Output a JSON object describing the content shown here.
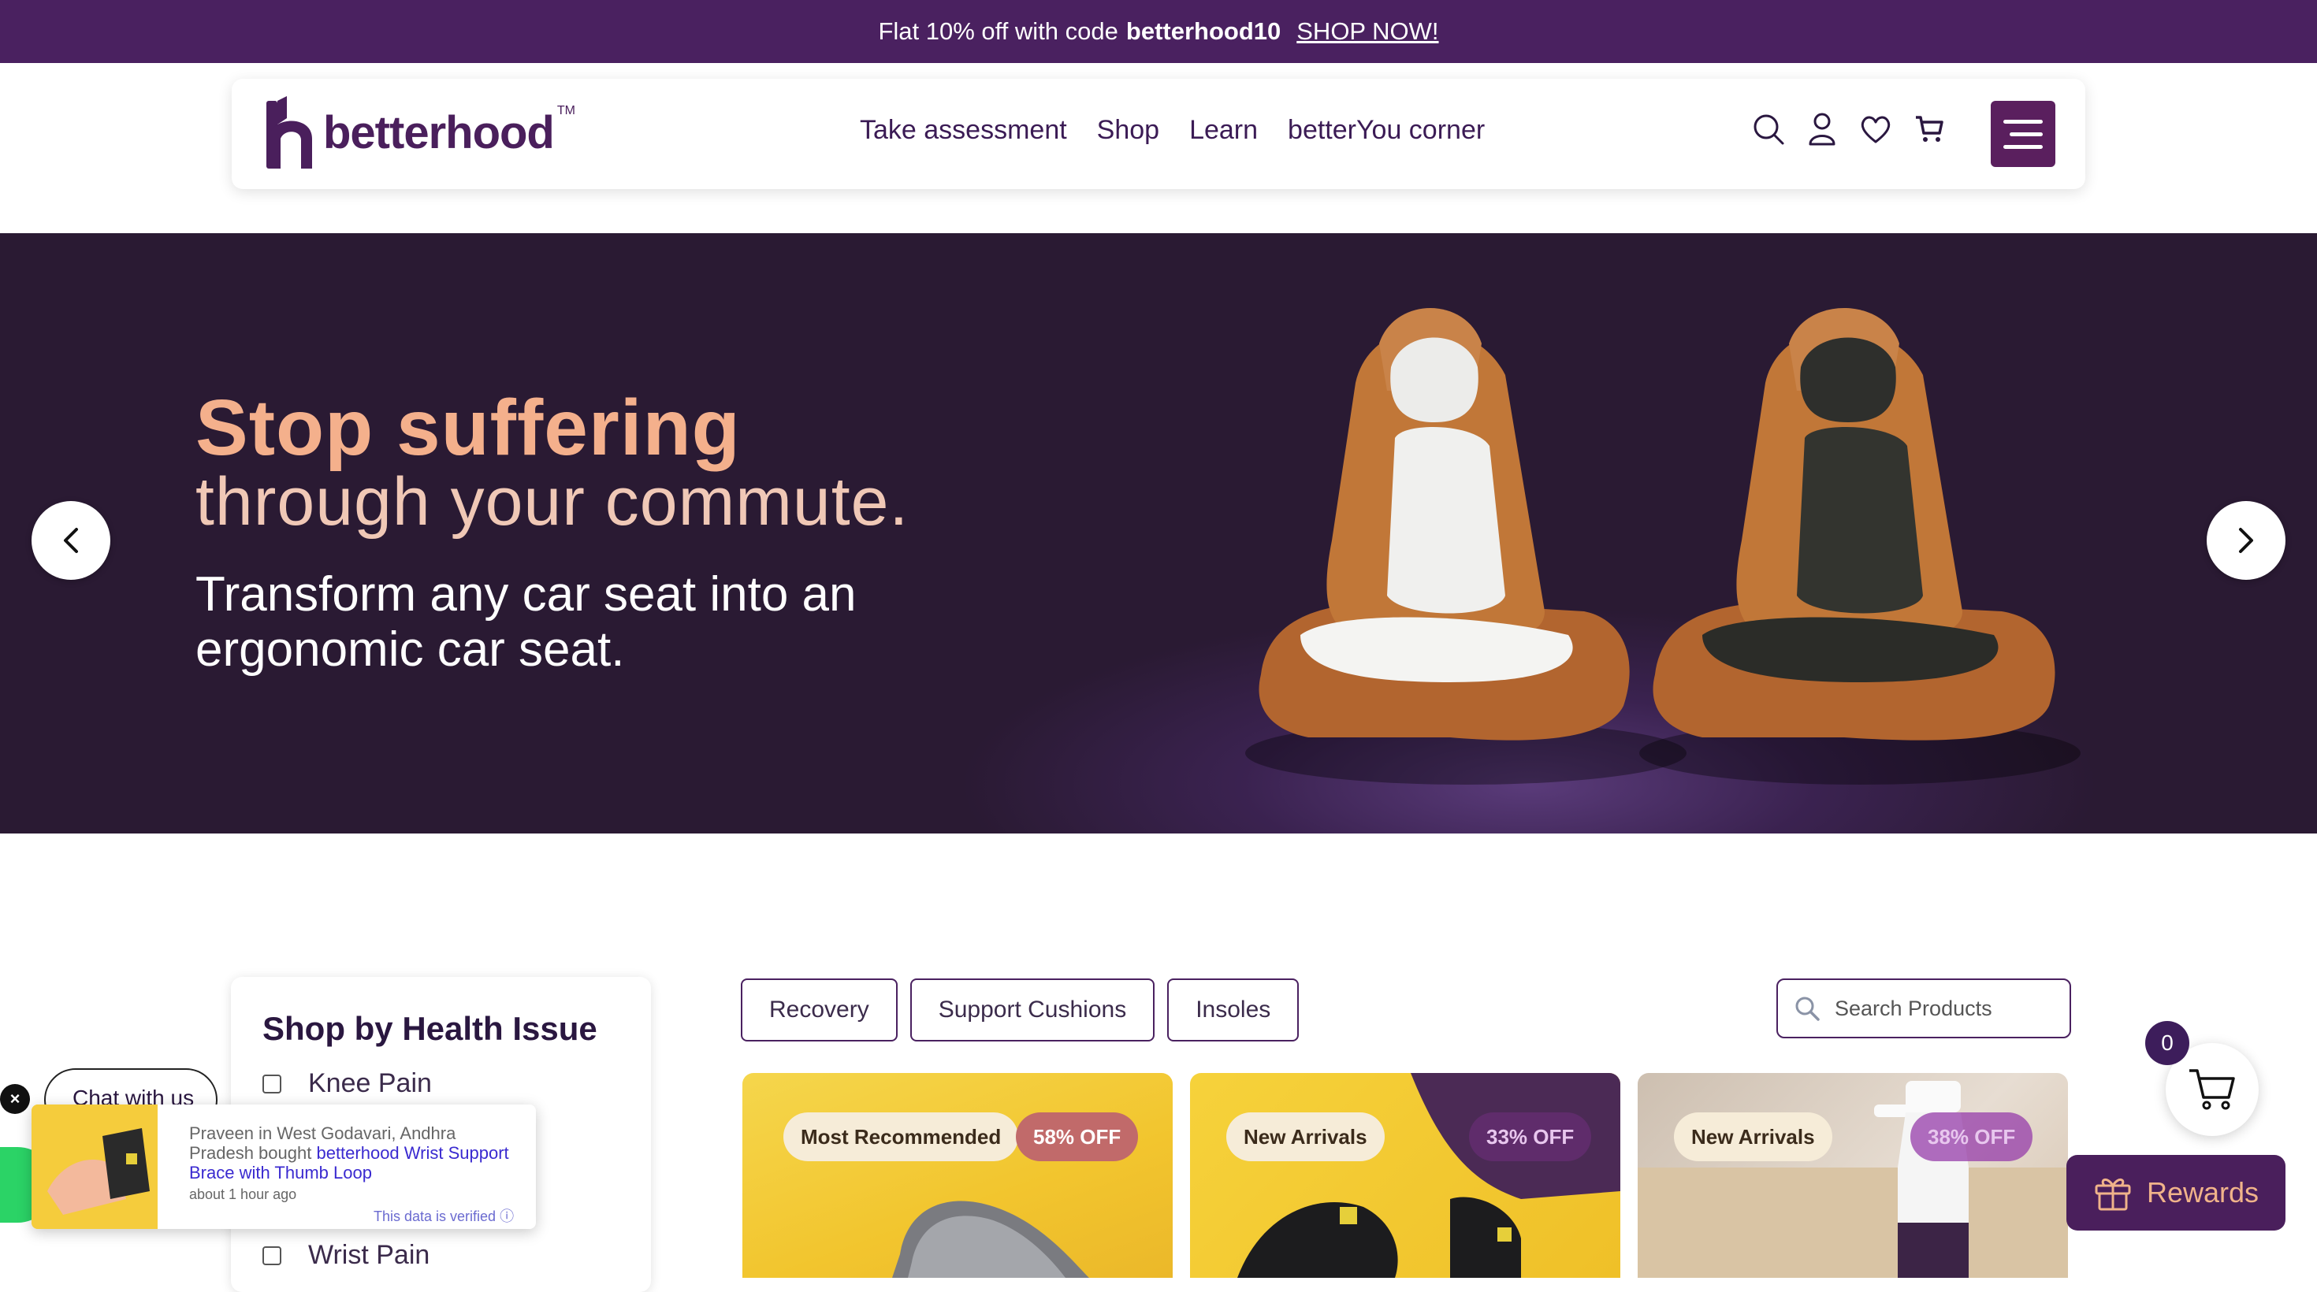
{
  "announcement": {
    "prefix": "Flat 10% off with code",
    "code": "betterhood10",
    "cta": "SHOP NOW!"
  },
  "header": {
    "brand": "betterhood",
    "trademark": "TM",
    "nav": [
      "Take assessment",
      "Shop",
      "Learn",
      "betterYou corner"
    ],
    "icons": [
      "search-icon",
      "user-icon",
      "heart-icon",
      "cart-icon",
      "menu-icon"
    ]
  },
  "hero": {
    "headline": "Stop suffering",
    "subheadline": "through your commute.",
    "body": "Transform any car seat into an ergonomic car seat.",
    "colors": {
      "headline": "#f4b08c",
      "background": "#2a1a33"
    }
  },
  "sidebar": {
    "title": "Shop by Health Issue",
    "filters": [
      "Knee Pain",
      "Wrist Pain"
    ]
  },
  "tabs": [
    "Recovery",
    "Support Cushions",
    "Insoles"
  ],
  "search": {
    "placeholder": "Search Products"
  },
  "products": [
    {
      "tag": "Most Recommended",
      "discount": "58% OFF"
    },
    {
      "tag": "New Arrivals",
      "discount": "33% OFF"
    },
    {
      "tag": "New Arrivals",
      "discount": "38% OFF"
    }
  ],
  "chat": {
    "label": "Chat with us"
  },
  "toast": {
    "text": "Praveen in West Godavari, Andhra Pradesh bought",
    "product": "betterhood Wrist Support Brace with Thumb Loop",
    "time": "about 1 hour ago",
    "verified": "This data is verified ⓘ"
  },
  "cart": {
    "count": "0"
  },
  "rewards": {
    "label": "Rewards"
  }
}
